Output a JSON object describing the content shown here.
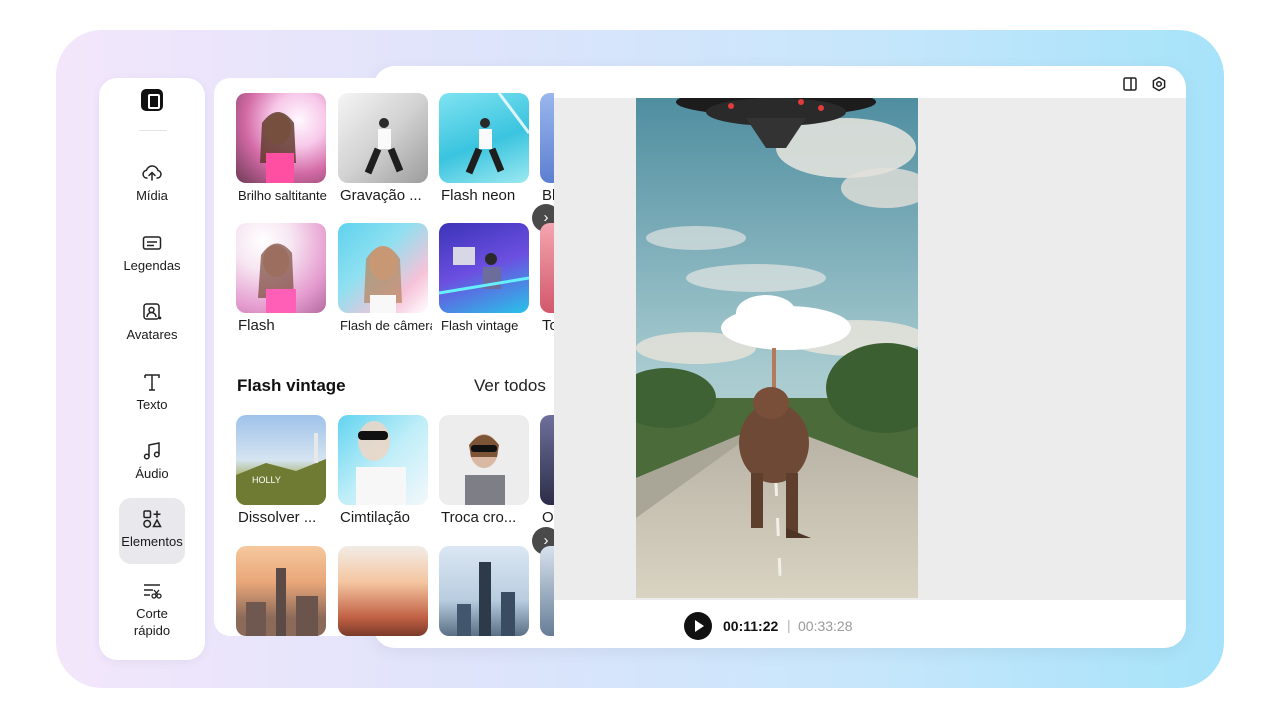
{
  "sidebar": {
    "items": [
      {
        "label": "Mídia",
        "icon": "cloud-upload-icon"
      },
      {
        "label": "Legendas",
        "icon": "captions-icon"
      },
      {
        "label": "Avatares",
        "icon": "avatar-icon"
      },
      {
        "label": "Texto",
        "icon": "text-icon"
      },
      {
        "label": "Áudio",
        "icon": "music-note-icon"
      },
      {
        "label": "Elementos",
        "icon": "elements-icon",
        "active": true
      },
      {
        "label": "Corte rápido",
        "icon": "quick-cut-icon"
      }
    ]
  },
  "effects": {
    "row1": [
      "Brilho saltitante",
      "Gravação ...",
      "Flash neon",
      "Bl"
    ],
    "row2": [
      "Flash",
      "Flash de câmera",
      "Flash vintage",
      "To"
    ],
    "section_title": "Flash vintage",
    "see_all": "Ver todos",
    "row3": [
      "Dissolver ...",
      "Cimtilação",
      "Troca cro...",
      "O"
    ],
    "arrow": "›"
  },
  "player": {
    "current_time": "00:11:22",
    "separator": "|",
    "total_time": "00:33:28"
  },
  "colors": {
    "accent": "#111111",
    "active_bg": "#e9e9ed"
  }
}
